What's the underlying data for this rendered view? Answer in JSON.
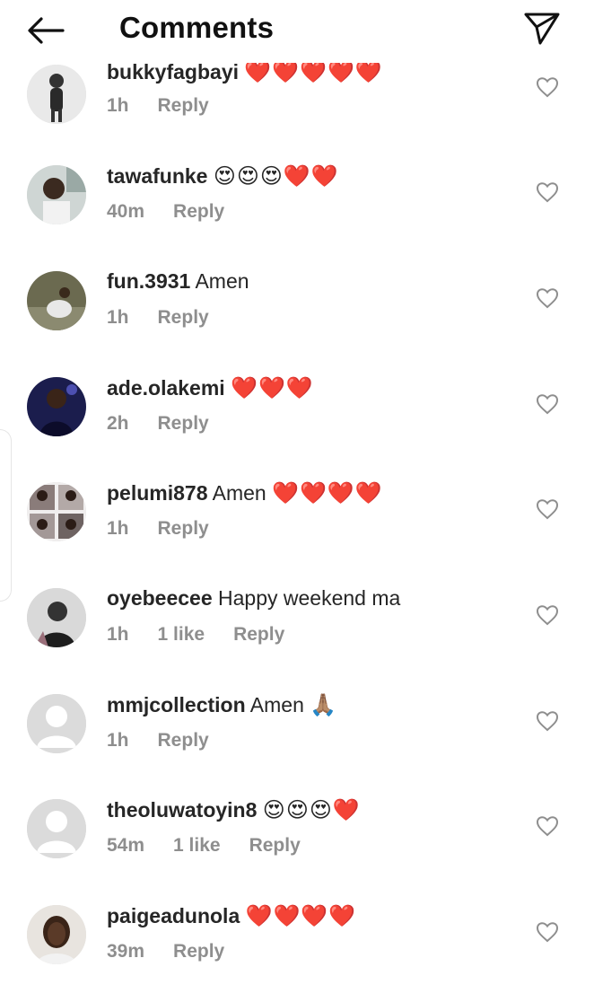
{
  "header": {
    "title": "Comments",
    "back_icon": "arrow-left-icon",
    "send_icon": "paper-plane-icon"
  },
  "colors": {
    "meta_gray": "#8e8e8e",
    "heart_red": "#e0223a",
    "avatar_placeholder": "#dbdbdb"
  },
  "comments": [
    {
      "username": "bukkyfagbayi",
      "text": "",
      "emojis": "❤️❤️❤️❤️❤️",
      "time": "1h",
      "likes": "",
      "reply": "Reply"
    },
    {
      "username": "tawafunke",
      "text": "",
      "emojis": "😍😍😍❤️❤️",
      "time": "40m",
      "likes": "",
      "reply": "Reply"
    },
    {
      "username": "fun.3931",
      "text": "Amen",
      "emojis": "",
      "time": "1h",
      "likes": "",
      "reply": "Reply"
    },
    {
      "username": "ade.olakemi",
      "text": "",
      "emojis": "❤️❤️❤️",
      "time": "2h",
      "likes": "",
      "reply": "Reply"
    },
    {
      "username": "pelumi878",
      "text": "Amen",
      "emojis": "❤️❤️❤️❤️",
      "time": "1h",
      "likes": "",
      "reply": "Reply"
    },
    {
      "username": "oyebeecee",
      "text": "Happy weekend ma",
      "emojis": "",
      "time": "1h",
      "likes": "1 like",
      "reply": "Reply"
    },
    {
      "username": "mmjcollection",
      "text": "Amen",
      "emojis": "🙏🏽",
      "time": "1h",
      "likes": "",
      "reply": "Reply"
    },
    {
      "username": "theoluwatoyin8",
      "text": "",
      "emojis": "😍😍😍❤️",
      "time": "54m",
      "likes": "1 like",
      "reply": "Reply"
    },
    {
      "username": "paigeadunola",
      "text": "",
      "emojis": "❤️❤️❤️❤️",
      "time": "39m",
      "likes": "",
      "reply": "Reply"
    }
  ]
}
